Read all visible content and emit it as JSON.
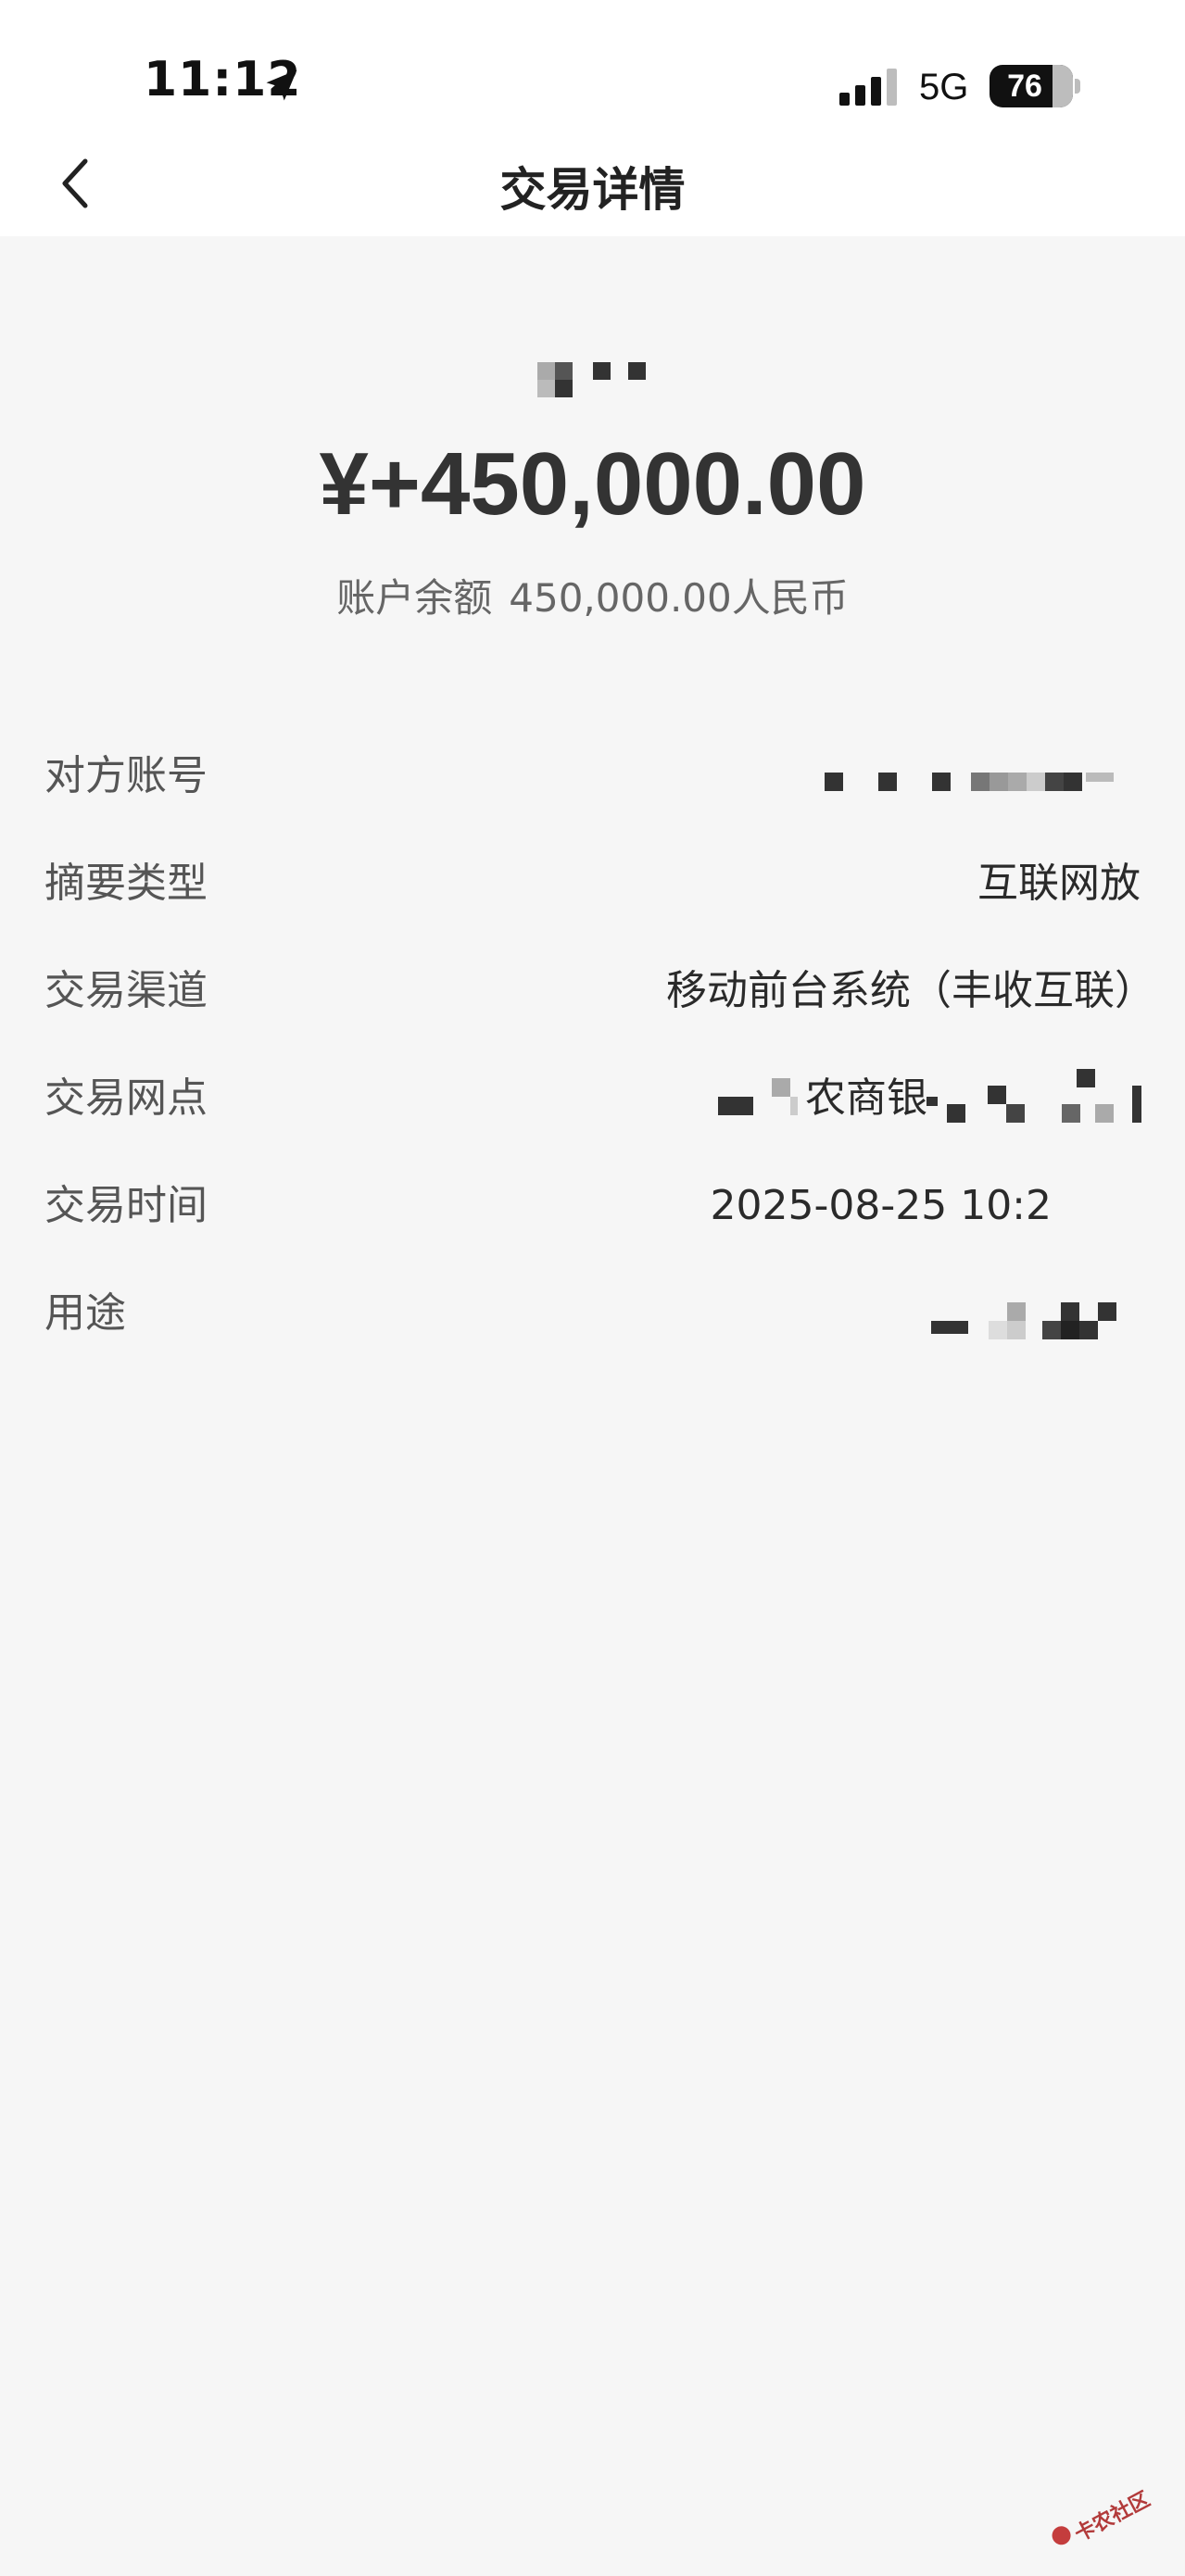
{
  "status_bar": {
    "time": "11:12",
    "network": "5G",
    "battery": "76",
    "battery_level": 0.76,
    "location_icon": "location-arrow-icon",
    "signal_icon": "cellular-signal-icon"
  },
  "nav": {
    "back_icon": "chevron-left-icon",
    "title": "交易详情"
  },
  "summary": {
    "amount": "¥+450,000.00",
    "balance_label": "账户余额",
    "balance_value": "450,000.00人民币"
  },
  "details": [
    {
      "label": "对方账号",
      "value": ""
    },
    {
      "label": "摘要类型",
      "value": "互联网放"
    },
    {
      "label": "交易渠道",
      "value": "移动前台系统（丰收互联）"
    },
    {
      "label": "交易网点",
      "value": "农商银"
    },
    {
      "label": "交易时间",
      "value": "2025-08-25 10:2"
    },
    {
      "label": "用途",
      "value": ""
    }
  ],
  "watermark": {
    "text": "卡农社区"
  },
  "colors": {
    "background": "#f6f6f6",
    "header": "#ffffff",
    "text": "#2a2a2a",
    "label": "#555555",
    "muted": "#666666"
  }
}
